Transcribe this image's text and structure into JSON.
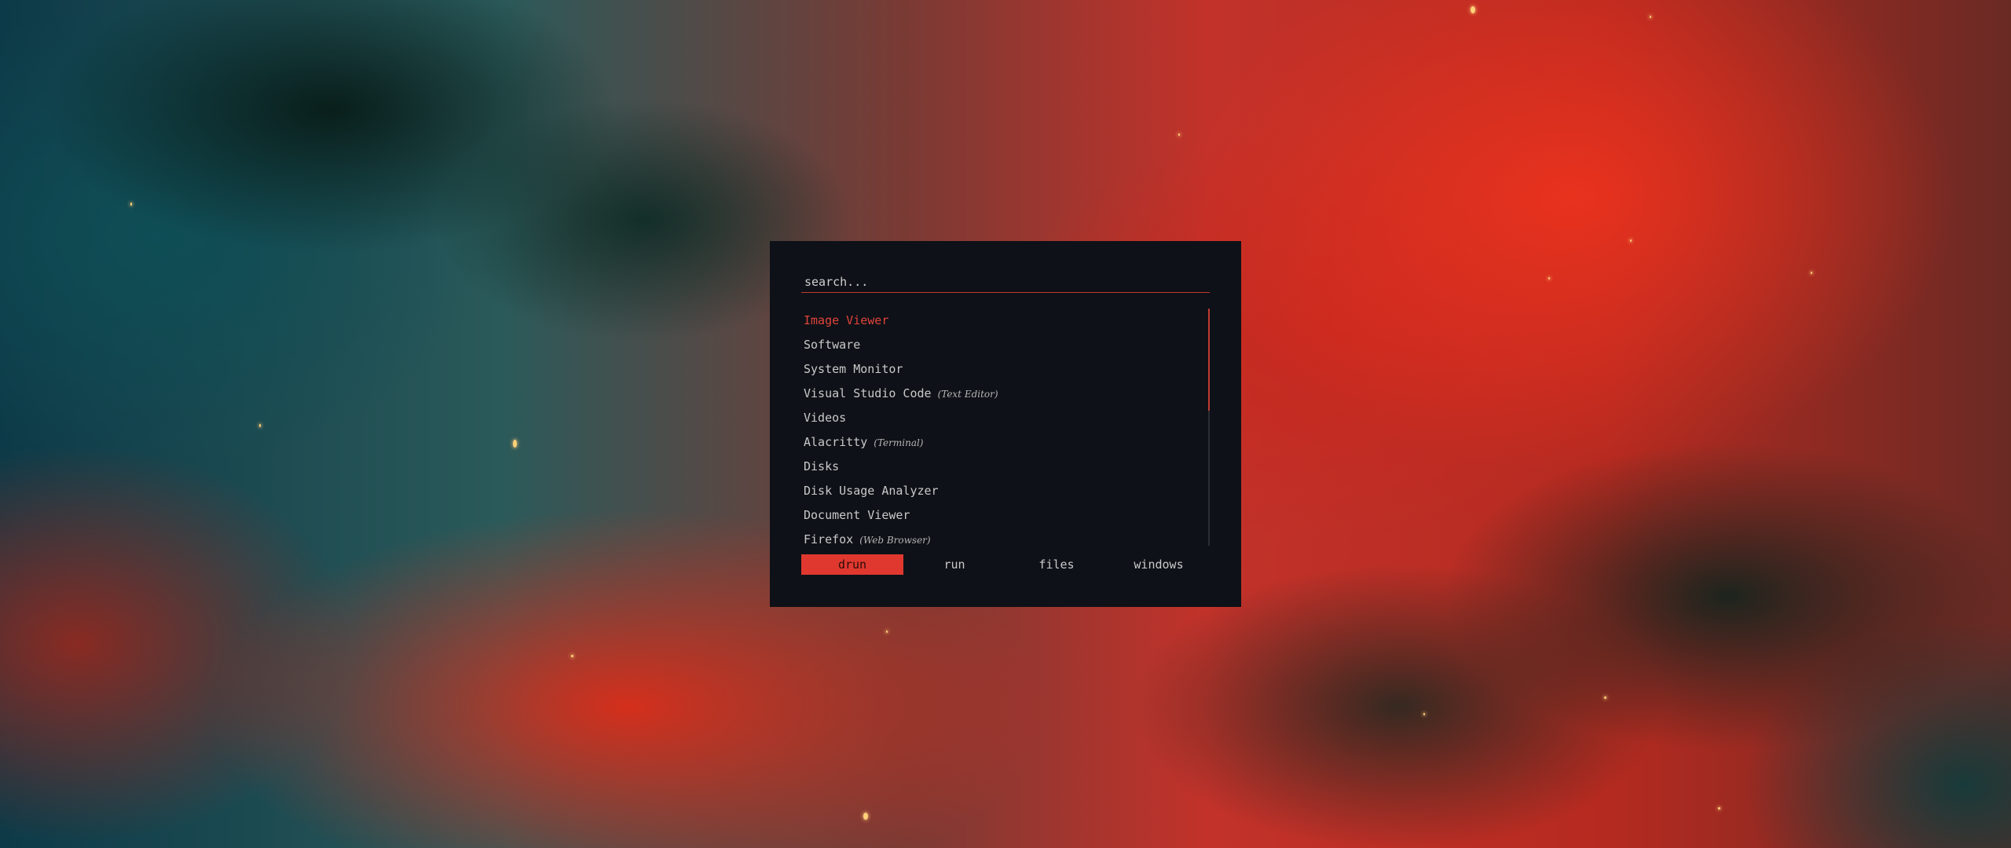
{
  "colors": {
    "accent": "#e0382f",
    "window_bg": "#0e1117",
    "text": "#c9c9c9"
  },
  "search": {
    "placeholder": "search...",
    "value": ""
  },
  "list": {
    "items": [
      {
        "name": "Image Viewer",
        "generic": "",
        "selected": true
      },
      {
        "name": "Software",
        "generic": ""
      },
      {
        "name": "System Monitor",
        "generic": ""
      },
      {
        "name": "Visual Studio Code",
        "generic": "(Text Editor)"
      },
      {
        "name": "Videos",
        "generic": ""
      },
      {
        "name": "Alacritty",
        "generic": "(Terminal)"
      },
      {
        "name": "Disks",
        "generic": ""
      },
      {
        "name": "Disk Usage Analyzer",
        "generic": ""
      },
      {
        "name": "Document Viewer",
        "generic": ""
      },
      {
        "name": "Firefox",
        "generic": "(Web Browser)"
      }
    ]
  },
  "modes": {
    "items": [
      {
        "label": "drun",
        "active": true
      },
      {
        "label": "run"
      },
      {
        "label": "files"
      },
      {
        "label": "windows"
      }
    ]
  }
}
